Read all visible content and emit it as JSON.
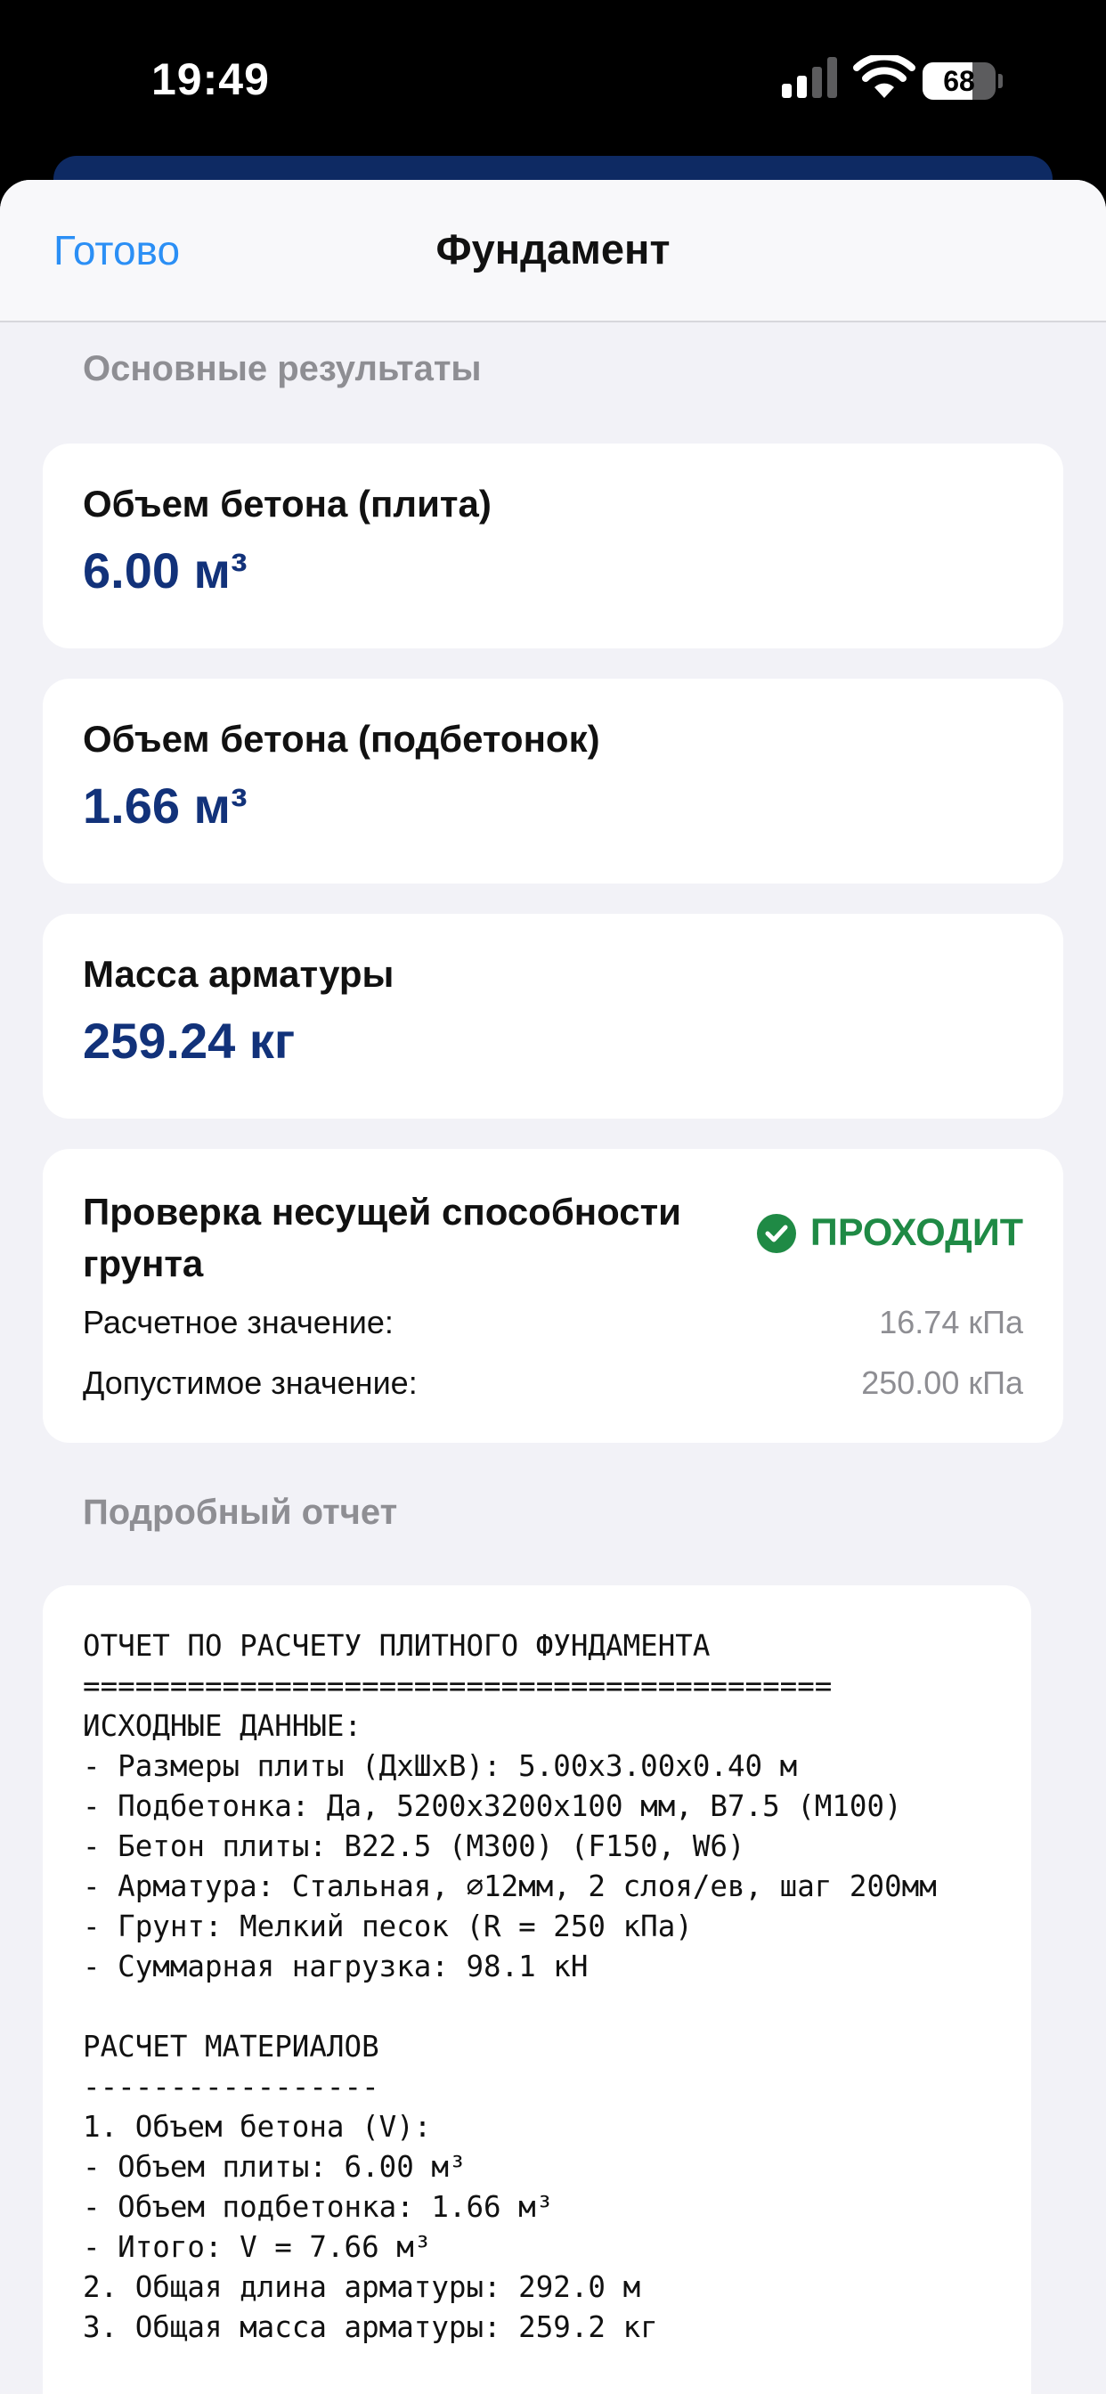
{
  "status_bar": {
    "time": "19:49",
    "battery_label": "68",
    "battery_level_percent": 68,
    "icons": [
      "cellular-signal-icon",
      "wifi-icon",
      "battery-icon"
    ]
  },
  "nav": {
    "done_label": "Готово",
    "title": "Фундамент"
  },
  "sections": {
    "main_results": "Основные результаты",
    "detailed_report": "Подробный отчет"
  },
  "results": [
    {
      "label": "Объем бетона (плита)",
      "value": "6.00 м³"
    },
    {
      "label": "Объем бетона (подбетонок)",
      "value": "1.66 м³"
    },
    {
      "label": "Масса арматуры",
      "value": "259.24 кг"
    }
  ],
  "bearing_check": {
    "title": "Проверка несущей способности грунта",
    "status": "ПРОХОДИТ",
    "rows": [
      {
        "label": "Расчетное значение:",
        "value": "16.74 кПа"
      },
      {
        "label": "Допустимое значение:",
        "value": "250.00 кПа"
      }
    ]
  },
  "report_text": "ОТЧЕТ ПО РАСЧЕТУ ПЛИТНОГО ФУНДАМЕНТА\n===========================================\nИСХОДНЫЕ ДАННЫЕ:\n- Размеры плиты (ДхШхВ): 5.00x3.00x0.40 м\n- Подбетонка: Да, 5200x3200x100 мм, B7.5 (M100)\n- Бетон плиты: B22.5 (M300) (F150, W6)\n- Арматура: Стальная, ⌀12мм, 2 слоя/ев, шаг 200мм\n- Грунт: Мелкий песок (R = 250 кПа)\n- Суммарная нагрузка: 98.1 кН\n\nРАСЧЕТ МАТЕРИАЛОВ\n-----------------\n1. Объем бетона (V):\n- Объем плиты: 6.00 м³\n- Объем подбетонка: 1.66 м³\n- Итого: V = 7.66 м³\n2. Общая длина арматуры: 292.0 м\n3. Общая масса арматуры: 259.2 кг",
  "colors": {
    "accent_blue": "#2b8ff5",
    "value_navy": "#12327a",
    "pass_green": "#1f8a45",
    "background": "#f2f2f7"
  }
}
